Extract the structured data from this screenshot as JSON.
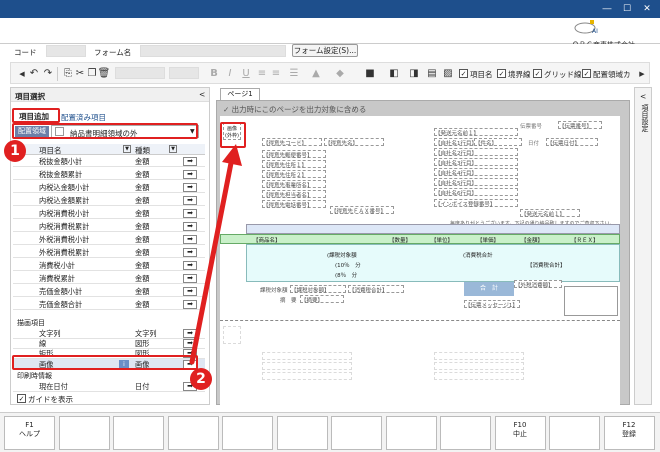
{
  "header": {
    "company": "ＯＢＣ商事株式会社",
    "logo_badge": "AI"
  },
  "form_row": {
    "code_label": "コード",
    "form_name_label": "フォーム名",
    "form_settings_button": "フォーム設定(S)..."
  },
  "toolbar": {
    "checkboxes": [
      {
        "label": "項目名",
        "checked": true
      },
      {
        "label": "境界線",
        "checked": true
      },
      {
        "label": "グリッド線",
        "checked": true
      },
      {
        "label": "配置領域カ",
        "checked": true
      }
    ]
  },
  "left_panel": {
    "title": "項目選択",
    "collapse": "<",
    "tab_add": "項目追加",
    "tab_placed": "配置済み項目",
    "area_label": "配置領域",
    "area_value": "納品書明細領域の外",
    "col_name": "項目名",
    "col_kind": "種類",
    "rows": [
      {
        "name": "税抜金額小計",
        "kind": "金額"
      },
      {
        "name": "税抜金額累計",
        "kind": "金額"
      },
      {
        "name": "内税込金額小計",
        "kind": "金額"
      },
      {
        "name": "内税込金額累計",
        "kind": "金額"
      },
      {
        "name": "内税消費税小計",
        "kind": "金額"
      },
      {
        "name": "内税消費税累計",
        "kind": "金額"
      },
      {
        "name": "外税消費税小計",
        "kind": "金額"
      },
      {
        "name": "外税消費税累計",
        "kind": "金額"
      },
      {
        "name": "消費税小計",
        "kind": "金額"
      },
      {
        "name": "消費税累計",
        "kind": "金額"
      },
      {
        "name": "売価金額小計",
        "kind": "金額"
      },
      {
        "name": "売価金額合計",
        "kind": "金額"
      }
    ],
    "group_drawing": "描画項目",
    "drawing_rows": [
      {
        "name": "文字列",
        "kind": "文字列"
      },
      {
        "name": "線",
        "kind": "図形"
      },
      {
        "name": "矩形",
        "kind": "図形"
      }
    ],
    "image_row": {
      "name": "画像",
      "kind": "画像"
    },
    "group_print": "印刷時情報",
    "print_rows": [
      {
        "name": "現在日付",
        "kind": "日付"
      }
    ],
    "guide_label": "ガイドを表示",
    "arrow_glyph": "➡"
  },
  "canvas": {
    "page_tab": "ページ1",
    "include_label": "出力時にこのページを出力対象に含める",
    "image_placeholder_l1": "画像",
    "image_placeholder_l2": "(外枠)",
    "fields_left": [
      "【得意先郵便番号】",
      "【得意先住所１】",
      "【得意先住所２】",
      "【得意先事業所名】",
      "【得意先担当者名】",
      "【得意先電話番号】"
    ],
    "field_code": "【得意先コード】",
    "field_name": "【得意先名】",
    "field_fax": "【得意先ＦＡＸ番号】",
    "fields_right": [
      "【発送元名前１】",
      "【自社名1行目】",
      "【自社名2行目】",
      "【自社名3行目】",
      "【自社名4行目】",
      "【自社名5行目】",
      "【自社名6行目】"
    ],
    "invoice_reg": "【インボイス登録番号】",
    "doc_no_label": "伝票番号",
    "doc_no": "【伝票番号】",
    "date_label": "日付",
    "date": "【伝票日付】",
    "subject": "【件名】",
    "sender": "【発送元名前１】",
    "greeting": "毎度ありがとうございます。下記の通り納品致しますのでご査収下さい。",
    "row_item": "【商品名】",
    "row_qty": "【数量】",
    "row_unit": "【単位】",
    "row_price": "【単価】",
    "row_amount": "【金額】",
    "row_tax": "【ＲＥＸ】",
    "tax_target": "(課税対象額",
    "tax_rate10": "(10％　分",
    "tax_rate8": "(8％　分",
    "tax_included": "(消費税合計",
    "tax_summary": "【消費税合計】",
    "total_label": "合　計",
    "summary_footer_left": "課税対象額",
    "summary_footer_val": "【課税対象額】",
    "summary_footer_tax": "【消費税合計】",
    "remark": "【摘要】",
    "remark_label": "摘　要",
    "tax_extra": "【外税消費額】",
    "statement": "【伝票メッセージ1】"
  },
  "right_tab": {
    "label": "項目設定",
    "collapse": "<"
  },
  "fkeys": [
    {
      "key": "F1",
      "label": "ヘルプ"
    },
    {
      "key": "",
      "label": ""
    },
    {
      "key": "",
      "label": ""
    },
    {
      "key": "",
      "label": ""
    },
    {
      "key": "",
      "label": ""
    },
    {
      "key": "",
      "label": ""
    },
    {
      "key": "",
      "label": ""
    },
    {
      "key": "",
      "label": ""
    },
    {
      "key": "",
      "label": ""
    },
    {
      "key": "F10",
      "label": "中止"
    },
    {
      "key": "",
      "label": ""
    },
    {
      "key": "F12",
      "label": "登録"
    }
  ],
  "callouts": [
    "1",
    "2"
  ]
}
